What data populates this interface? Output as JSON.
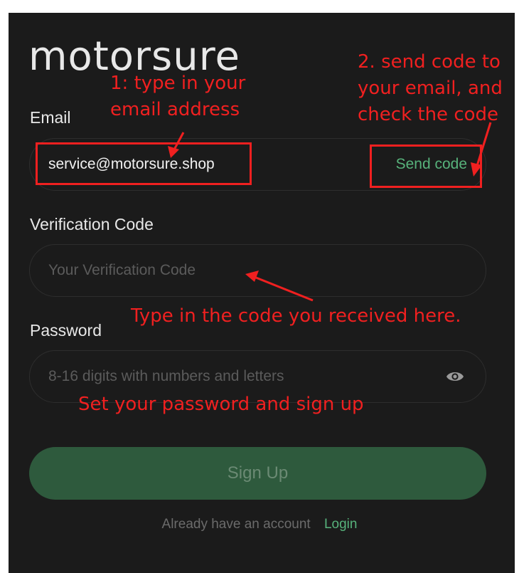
{
  "brand": {
    "logo": "motorsure"
  },
  "email": {
    "label": "Email",
    "value": "service@motorsure.shop",
    "send_code": "Send code"
  },
  "verification": {
    "label": "Verification Code",
    "placeholder": "Your Verification Code"
  },
  "password": {
    "label": "Password",
    "placeholder": "8-16 digits with numbers and letters",
    "toggle_icon": "eye-icon"
  },
  "signup": {
    "button_label": "Sign Up"
  },
  "footer": {
    "text": "Already have an account",
    "login_link": "Login"
  },
  "annotations": {
    "step1_line1": "1:   type in your",
    "step1_line2": "email address",
    "step2_line1": "2. send code to",
    "step2_line2": "your email, and",
    "step2_line3": "check the code",
    "code_hint": "Type in the code you received here.",
    "password_hint": "Set your password and sign up"
  },
  "colors": {
    "background": "#1b1b1b",
    "accent": "#57b27b",
    "button": "#2e5a3d",
    "annotation": "#f02020"
  }
}
